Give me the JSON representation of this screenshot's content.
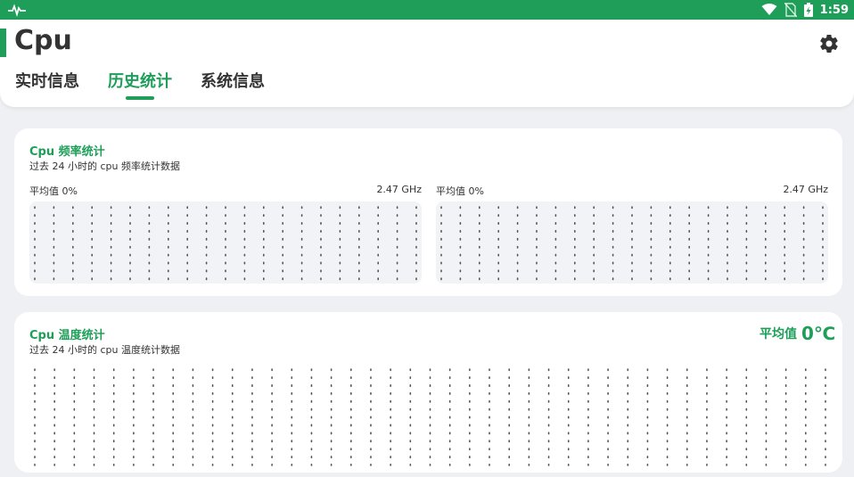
{
  "status_bar": {
    "time": "1:59",
    "icons": [
      "activity-icon",
      "wifi-icon",
      "no-sim-icon",
      "battery-charging-icon"
    ]
  },
  "header": {
    "title": "Cpu",
    "settings_icon": "gear-icon",
    "tabs": [
      {
        "label": "实时信息",
        "active": false
      },
      {
        "label": "历史统计",
        "active": true
      },
      {
        "label": "系统信息",
        "active": false
      }
    ]
  },
  "freq_card": {
    "title": "Cpu 频率统计",
    "subtitle": "过去 24 小时的 cpu 频率统计数据",
    "panels": [
      {
        "avg_label": "平均值 0%",
        "max_label": "2.47 GHz"
      },
      {
        "avg_label": "平均值 0%",
        "max_label": "2.47 GHz"
      }
    ]
  },
  "temp_card": {
    "title": "Cpu 温度统计",
    "subtitle": "过去 24 小时的 cpu 温度统计数据",
    "avg_label": "平均值",
    "avg_value": "0℃"
  },
  "colors": {
    "accent": "#1e9e58",
    "background": "#eef0f3",
    "card": "#ffffff",
    "chart_bg": "#f1f3f6"
  }
}
